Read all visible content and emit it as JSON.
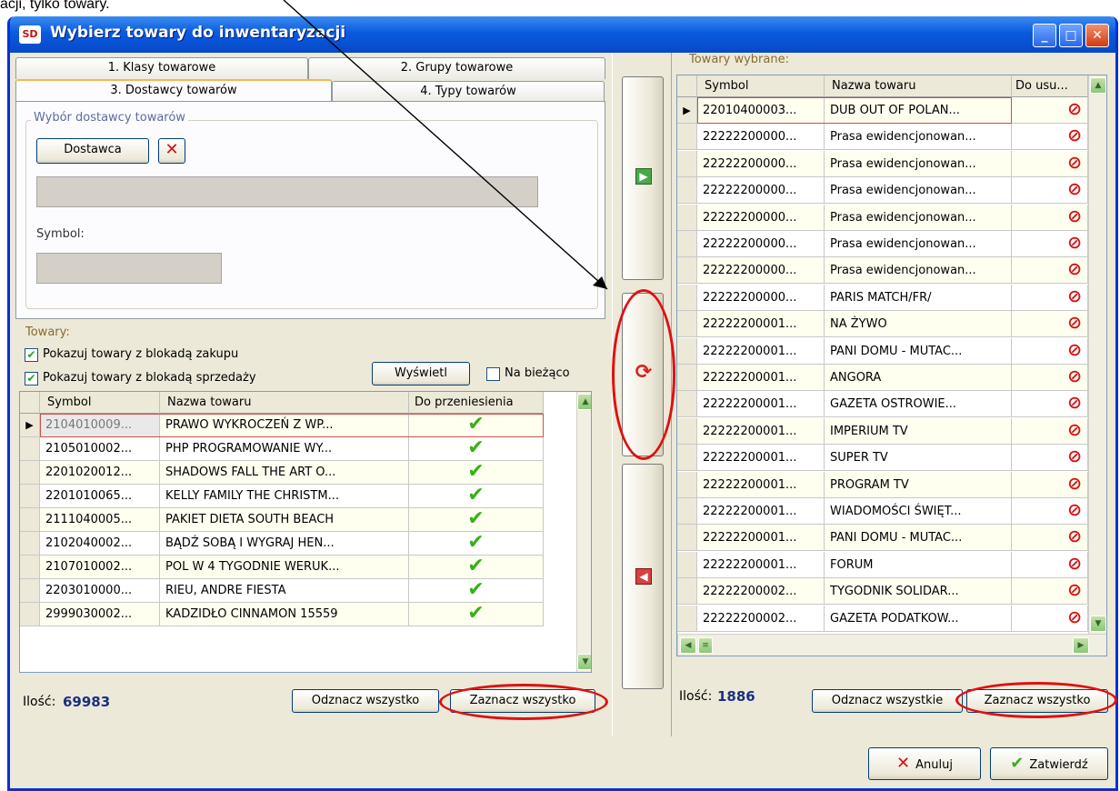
{
  "page_caption": "acji, tylko towary.",
  "window": {
    "title": "Wybierz towary do inwentaryzacji",
    "app_icon": "SD",
    "min": "_",
    "max": "□",
    "close": "✕"
  },
  "tabs": [
    {
      "label": "1. Klasy towarowe"
    },
    {
      "label": "2. Grupy towarowe"
    },
    {
      "label": "3. Dostawcy towarów"
    },
    {
      "label": "4. Typy towarów"
    }
  ],
  "supplier": {
    "group_title": "Wybór dostawcy towarów",
    "button": "Dostawca",
    "symbol_label": "Symbol:"
  },
  "goods": {
    "group_title": "Towary:",
    "chk_block_purchase": "Pokazuj towary z blokadą zakupu",
    "chk_block_sale": "Pokazuj towary z blokadą sprzedaży",
    "show_btn": "Wyświetl",
    "live_label": "Na bieżąco",
    "columns": [
      "Symbol",
      "Nazwa towaru",
      "Do przeniesienia"
    ],
    "rows": [
      {
        "symbol": "2104010009...",
        "name": "PRAWO WYKROCZEŃ Z WP..."
      },
      {
        "symbol": "2105010002...",
        "name": "PHP PROGRAMOWANIE WY..."
      },
      {
        "symbol": "2201020012...",
        "name": "SHADOWS FALL THE ART O..."
      },
      {
        "symbol": "2201010065...",
        "name": "KELLY FAMILY THE CHRISTM..."
      },
      {
        "symbol": "2111040005...",
        "name": "PAKIET DIETA SOUTH BEACH"
      },
      {
        "symbol": "2102040002...",
        "name": "BĄDŹ SOBĄ I WYGRAJ HEN..."
      },
      {
        "symbol": "2107010002...",
        "name": "POL W 4 TYGODNIE WERUK..."
      },
      {
        "symbol": "2203010000...",
        "name": "RIEU, ANDRE FIESTA"
      },
      {
        "symbol": "2999030002...",
        "name": "KADZIDŁO CINNAMON 15559"
      }
    ],
    "count_label": "Ilość:",
    "count": "69983",
    "deselect_all": "Odznacz wszystko",
    "select_all": "Zaznacz wszystko"
  },
  "selected": {
    "group_title": "Towary wybrane:",
    "columns": [
      "Symbol",
      "Nazwa towaru",
      "Do usu..."
    ],
    "rows": [
      {
        "symbol": "22010400003...",
        "name": "DUB OUT OF POLAN..."
      },
      {
        "symbol": "22222200000...",
        "name": "Prasa ewidencjonowan..."
      },
      {
        "symbol": "22222200000...",
        "name": "Prasa ewidencjonowan..."
      },
      {
        "symbol": "22222200000...",
        "name": "Prasa ewidencjonowan..."
      },
      {
        "symbol": "22222200000...",
        "name": "Prasa ewidencjonowan..."
      },
      {
        "symbol": "22222200000...",
        "name": "Prasa ewidencjonowan..."
      },
      {
        "symbol": "22222200000...",
        "name": "Prasa ewidencjonowan..."
      },
      {
        "symbol": "22222200000...",
        "name": "PARIS MATCH/FR/"
      },
      {
        "symbol": "22222200001...",
        "name": "NA ŻYWO"
      },
      {
        "symbol": "22222200001...",
        "name": "PANI DOMU - MUTAC..."
      },
      {
        "symbol": "22222200001...",
        "name": "ANGORA"
      },
      {
        "symbol": "22222200001...",
        "name": "GAZETA OSTROWIE..."
      },
      {
        "symbol": "22222200001...",
        "name": "IMPERIUM TV"
      },
      {
        "symbol": "22222200001...",
        "name": "SUPER TV"
      },
      {
        "symbol": "22222200001...",
        "name": "PROGRAM TV"
      },
      {
        "symbol": "22222200001...",
        "name": "WIADOMOŚCI ŚWIĘT..."
      },
      {
        "symbol": "22222200001...",
        "name": "PANI DOMU - MUTAC..."
      },
      {
        "symbol": "22222200001...",
        "name": "FORUM"
      },
      {
        "symbol": "22222200002...",
        "name": "TYGODNIK SOLIDAR..."
      },
      {
        "symbol": "22222200002...",
        "name": "GAZETA PODATKOW..."
      }
    ],
    "count_label": "Ilość:",
    "count": "1886",
    "deselect_all": "Odznacz wszystkie",
    "select_all": "Zaznacz wszystko"
  },
  "footer": {
    "cancel": "Anuluj",
    "confirm": "Zatwierdź"
  },
  "icons": {
    "move_right": "move-right-icon",
    "refresh": "refresh-icon",
    "move_left": "move-left-icon",
    "check": "✔",
    "remove": "⊘"
  },
  "colors": {
    "title_bar": "#0a5ae0",
    "highlight_ring": "#e01010",
    "check_green": "#38b018",
    "remove_red": "#d81010",
    "count_blue": "#1a3080"
  }
}
